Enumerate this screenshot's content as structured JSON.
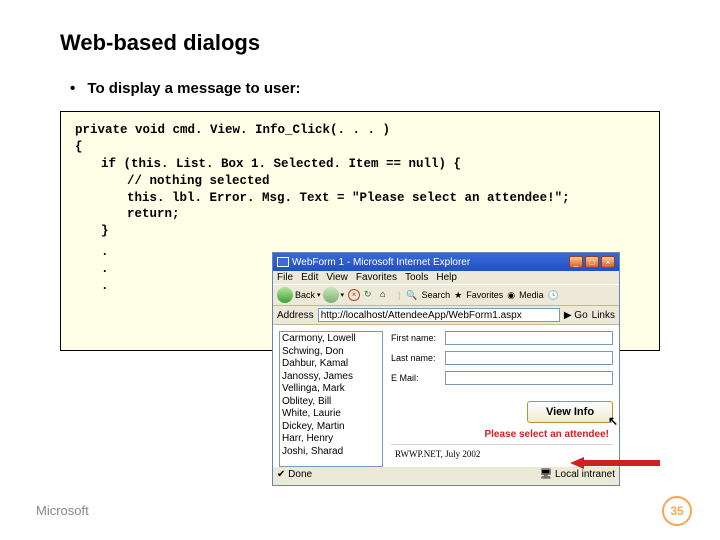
{
  "slide": {
    "title": "Web-based dialogs",
    "bullet": "To display a message to user:"
  },
  "code": {
    "l1": "private void cmd. View. Info_Click(. . . )",
    "l2": "{",
    "l3": "if (this. List. Box 1. Selected. Item == null) {",
    "l4": "// nothing selected",
    "l5": "this. lbl. Error. Msg. Text = \"Please select an attendee!\";",
    "l6": "return;",
    "l7": "}",
    "d1": ".",
    "d2": ".",
    "d3": "."
  },
  "browser": {
    "title": "WebForm 1 - Microsoft Internet Explorer",
    "menu": {
      "file": "File",
      "edit": "Edit",
      "view": "View",
      "favorites": "Favorites",
      "tools": "Tools",
      "help": "Help"
    },
    "toolbar": {
      "back": "Back",
      "search": "Search",
      "favorites": "Favorites",
      "media": "Media"
    },
    "address_label": "Address",
    "address_value": "http://localhost/AttendeeApp/WebForm1.aspx",
    "go": "Go",
    "links": "Links",
    "list": [
      "Carmony, Lowell",
      "Schwing, Don",
      "Dahbur, Kamal",
      "Janossy, James",
      "Vellinga, Mark",
      "Oblitey, Bill",
      "White, Laurie",
      "Dickey, Martin",
      "Harr, Henry",
      "Joshi, Sharad"
    ],
    "form": {
      "first": "First name:",
      "last": "Last name:",
      "email": "E Mail:"
    },
    "button": "View Info",
    "error": "Please select an attendee!",
    "rwwp": "RWWP.NET, July 2002",
    "status_done": "Done",
    "status_zone": "Local intranet"
  },
  "footer": {
    "logo": "Microsoft",
    "page": "35"
  }
}
